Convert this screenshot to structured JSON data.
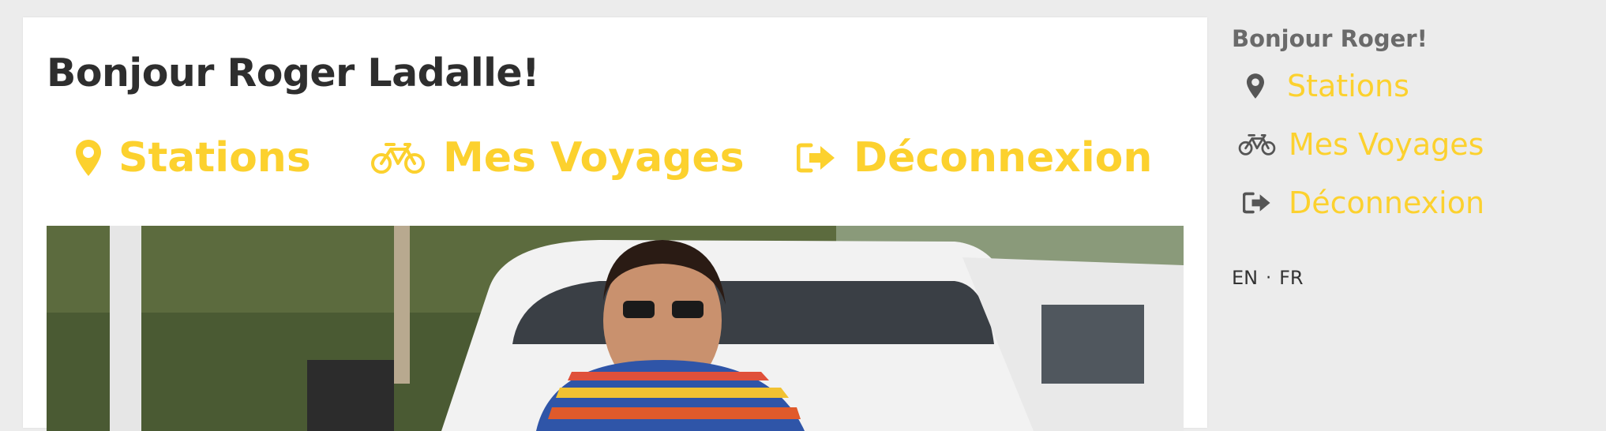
{
  "main": {
    "title": "Bonjour Roger Ladalle!",
    "nav": {
      "stations": "Stations",
      "voyages": "Mes Voyages",
      "logout": "Déconnexion"
    }
  },
  "sidebar": {
    "greeting": "Bonjour Roger!",
    "nav": {
      "stations": "Stations",
      "voyages": "Mes Voyages",
      "logout": "Déconnexion"
    }
  },
  "languages": {
    "en": "EN",
    "separator": "·",
    "fr": "FR"
  },
  "icons": {
    "stations": "map-marker-icon",
    "voyages": "bicycle-icon",
    "logout": "sign-out-icon"
  },
  "colors": {
    "accent": "#fcd12e",
    "background": "#ececec",
    "title": "#2e2e2e",
    "sidebar_greeting": "#6a6a6a",
    "sidebar_icon": "#555555"
  }
}
